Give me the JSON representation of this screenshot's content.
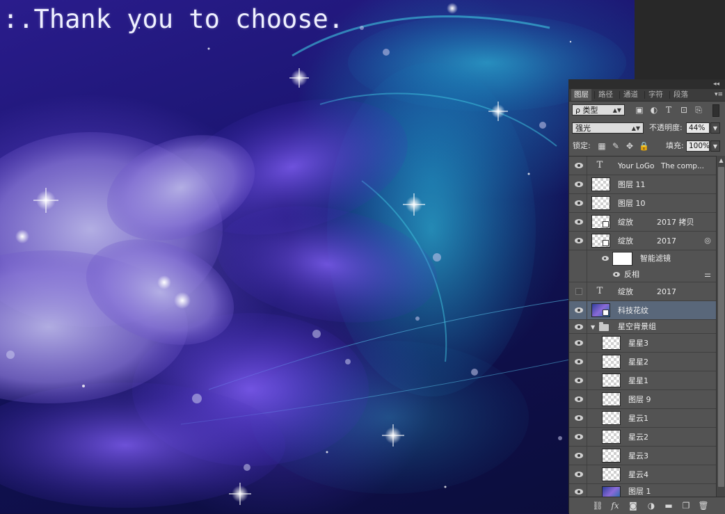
{
  "canvas": {
    "caption": ":.Thank you to choose."
  },
  "panel": {
    "collapse_label": "◂◂",
    "tabs": [
      "图层",
      "路径",
      "通道",
      "字符",
      "段落"
    ],
    "menu_icon": "panel-menu-icon",
    "filter": {
      "label": "ρ 类型"
    },
    "blend_mode": {
      "value": "强光"
    },
    "opacity": {
      "label": "不透明度:",
      "value": "44%"
    },
    "lock": {
      "label": "锁定:"
    },
    "fill": {
      "label": "填充:",
      "value": "100%"
    }
  },
  "layers": [
    {
      "name": "Your LoGo",
      "extra": "The  comp...",
      "kind": "text",
      "visible": true
    },
    {
      "name": "图层 11",
      "kind": "pixel",
      "visible": true
    },
    {
      "name": "图层 10",
      "kind": "pixel",
      "visible": true
    },
    {
      "name": "绽放",
      "extra": "2017 拷贝",
      "kind": "smart",
      "visible": true
    },
    {
      "name": "绽放",
      "extra": "2017",
      "kind": "smart",
      "visible": true
    },
    {
      "name": "智能滤镜",
      "kind": "filter-mask",
      "visible": true
    },
    {
      "name": "反相",
      "kind": "filter-item",
      "visible": true
    },
    {
      "name": "绽放",
      "extra": "2017",
      "kind": "text",
      "visible": false
    },
    {
      "name": "科技花纹",
      "kind": "photo",
      "visible": true,
      "selected": true
    },
    {
      "name": "星空背景组",
      "kind": "group",
      "visible": true
    },
    {
      "name": "星星3",
      "kind": "pixel",
      "visible": true
    },
    {
      "name": "星星2",
      "kind": "pixel",
      "visible": true
    },
    {
      "name": "星星1",
      "kind": "pixel",
      "visible": true
    },
    {
      "name": "图层 9",
      "kind": "pixel",
      "visible": true
    },
    {
      "name": "星云1",
      "kind": "pixel",
      "visible": true
    },
    {
      "name": "星云2",
      "kind": "pixel",
      "visible": true
    },
    {
      "name": "星云3",
      "kind": "pixel",
      "visible": true
    },
    {
      "name": "星云4",
      "kind": "pixel",
      "visible": true
    },
    {
      "name": "图层 1",
      "kind": "photo",
      "visible": true
    }
  ],
  "text_glyph": "T",
  "bottom_icons": [
    "link-layers-icon",
    "fx-icon",
    "add-mask-icon",
    "adjustment-layer-icon",
    "new-group-icon",
    "new-layer-icon",
    "delete-layer-icon"
  ]
}
